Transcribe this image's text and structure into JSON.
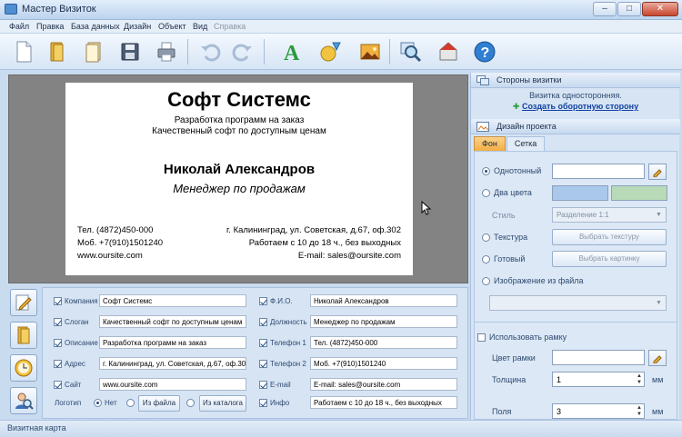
{
  "window": {
    "title": "Мастер Визиток"
  },
  "menu": [
    {
      "label": "Файл",
      "enabled": true
    },
    {
      "label": "Правка",
      "enabled": true
    },
    {
      "label": "База данных",
      "enabled": true
    },
    {
      "label": "Дизайн",
      "enabled": true
    },
    {
      "label": "Объект",
      "enabled": true
    },
    {
      "label": "Вид",
      "enabled": true
    },
    {
      "label": "Справка",
      "enabled": false
    }
  ],
  "toolbar": {
    "icons": [
      "new-document-icon",
      "open-folder-icon",
      "templates-icon",
      "save-icon",
      "print-icon",
      "undo-icon",
      "redo-icon",
      "text-icon",
      "shapes-icon",
      "image-icon",
      "zoom-icon",
      "share-icon",
      "help-icon"
    ]
  },
  "card": {
    "company": "Софт Системс",
    "slogan": "Разработка программ на заказ",
    "description": "Качественный софт по доступным ценам",
    "fio": "Николай Александров",
    "position": "Менеджер по продажам",
    "phone1": "Тел. (4872)450-000",
    "phone2": "Моб. +7(910)1501240",
    "site": "www.oursite.com",
    "address": "г. Калининград, ул. Советская, д.67, оф.302",
    "hours": "Работаем с 10 до 18 ч., без выходных",
    "email": "E-mail: sales@oursite.com"
  },
  "fields": {
    "left": [
      {
        "label": "Компания",
        "value": "Софт Системс",
        "checked": true
      },
      {
        "label": "Слоган",
        "value": "Качественный софт по доступным ценам",
        "checked": true
      },
      {
        "label": "Описание",
        "value": "Разработка программ на заказ",
        "checked": true
      },
      {
        "label": "Адрес",
        "value": "г. Калининград, ул. Советская, д.67, оф.30",
        "checked": true
      },
      {
        "label": "Сайт",
        "value": "www.oursite.com",
        "checked": true
      }
    ],
    "right": [
      {
        "label": "Ф.И.О.",
        "value": "Николай Александров",
        "checked": true
      },
      {
        "label": "Должность",
        "value": "Менеджер по продажам",
        "checked": true
      },
      {
        "label": "Телефон 1",
        "value": "Тел. (4872)450-000",
        "checked": true
      },
      {
        "label": "Телефон 2",
        "value": "Моб. +7(910)1501240",
        "checked": true
      },
      {
        "label": "E-mail",
        "value": "E-mail: sales@oursite.com",
        "checked": true
      },
      {
        "label": "Инфо",
        "value": "Работаем с 10 до 18 ч., без выходных",
        "checked": true
      }
    ],
    "logo": {
      "label": "Логотип",
      "option_none": "Нет",
      "from_file": "Из файла",
      "from_catalog": "Из каталога"
    }
  },
  "sides_panel": {
    "title": "Стороны визитки",
    "info": "Визитка односторонняя.",
    "create_back_link": "Создать оборотную сторону"
  },
  "design_panel": {
    "title": "Дизайн проекта",
    "tabs": [
      "Фон",
      "Сетка"
    ],
    "active_tab": "Фон",
    "one_color": "Однотонный",
    "two_colors": "Два цвета",
    "style_label": "Стиль",
    "style_value": "Разделение 1:1",
    "texture": "Текстура",
    "choose_texture": "Выбрать текстуру",
    "ready": "Готовый",
    "choose_picture": "Выбрать картинку",
    "image_from_file": "Изображение из файла",
    "use_frame": "Использовать рамку",
    "frame_color": "Цвет рамки",
    "thickness_label": "Толщина",
    "thickness_value": "1",
    "fields_label": "Поля",
    "fields_value": "3",
    "unit": "мм",
    "colors": {
      "one_color": "#ffffff",
      "two_color_1": "#a9c8ec",
      "two_color_2": "#b9dab7"
    }
  },
  "status": {
    "text": "Визитная карта"
  }
}
